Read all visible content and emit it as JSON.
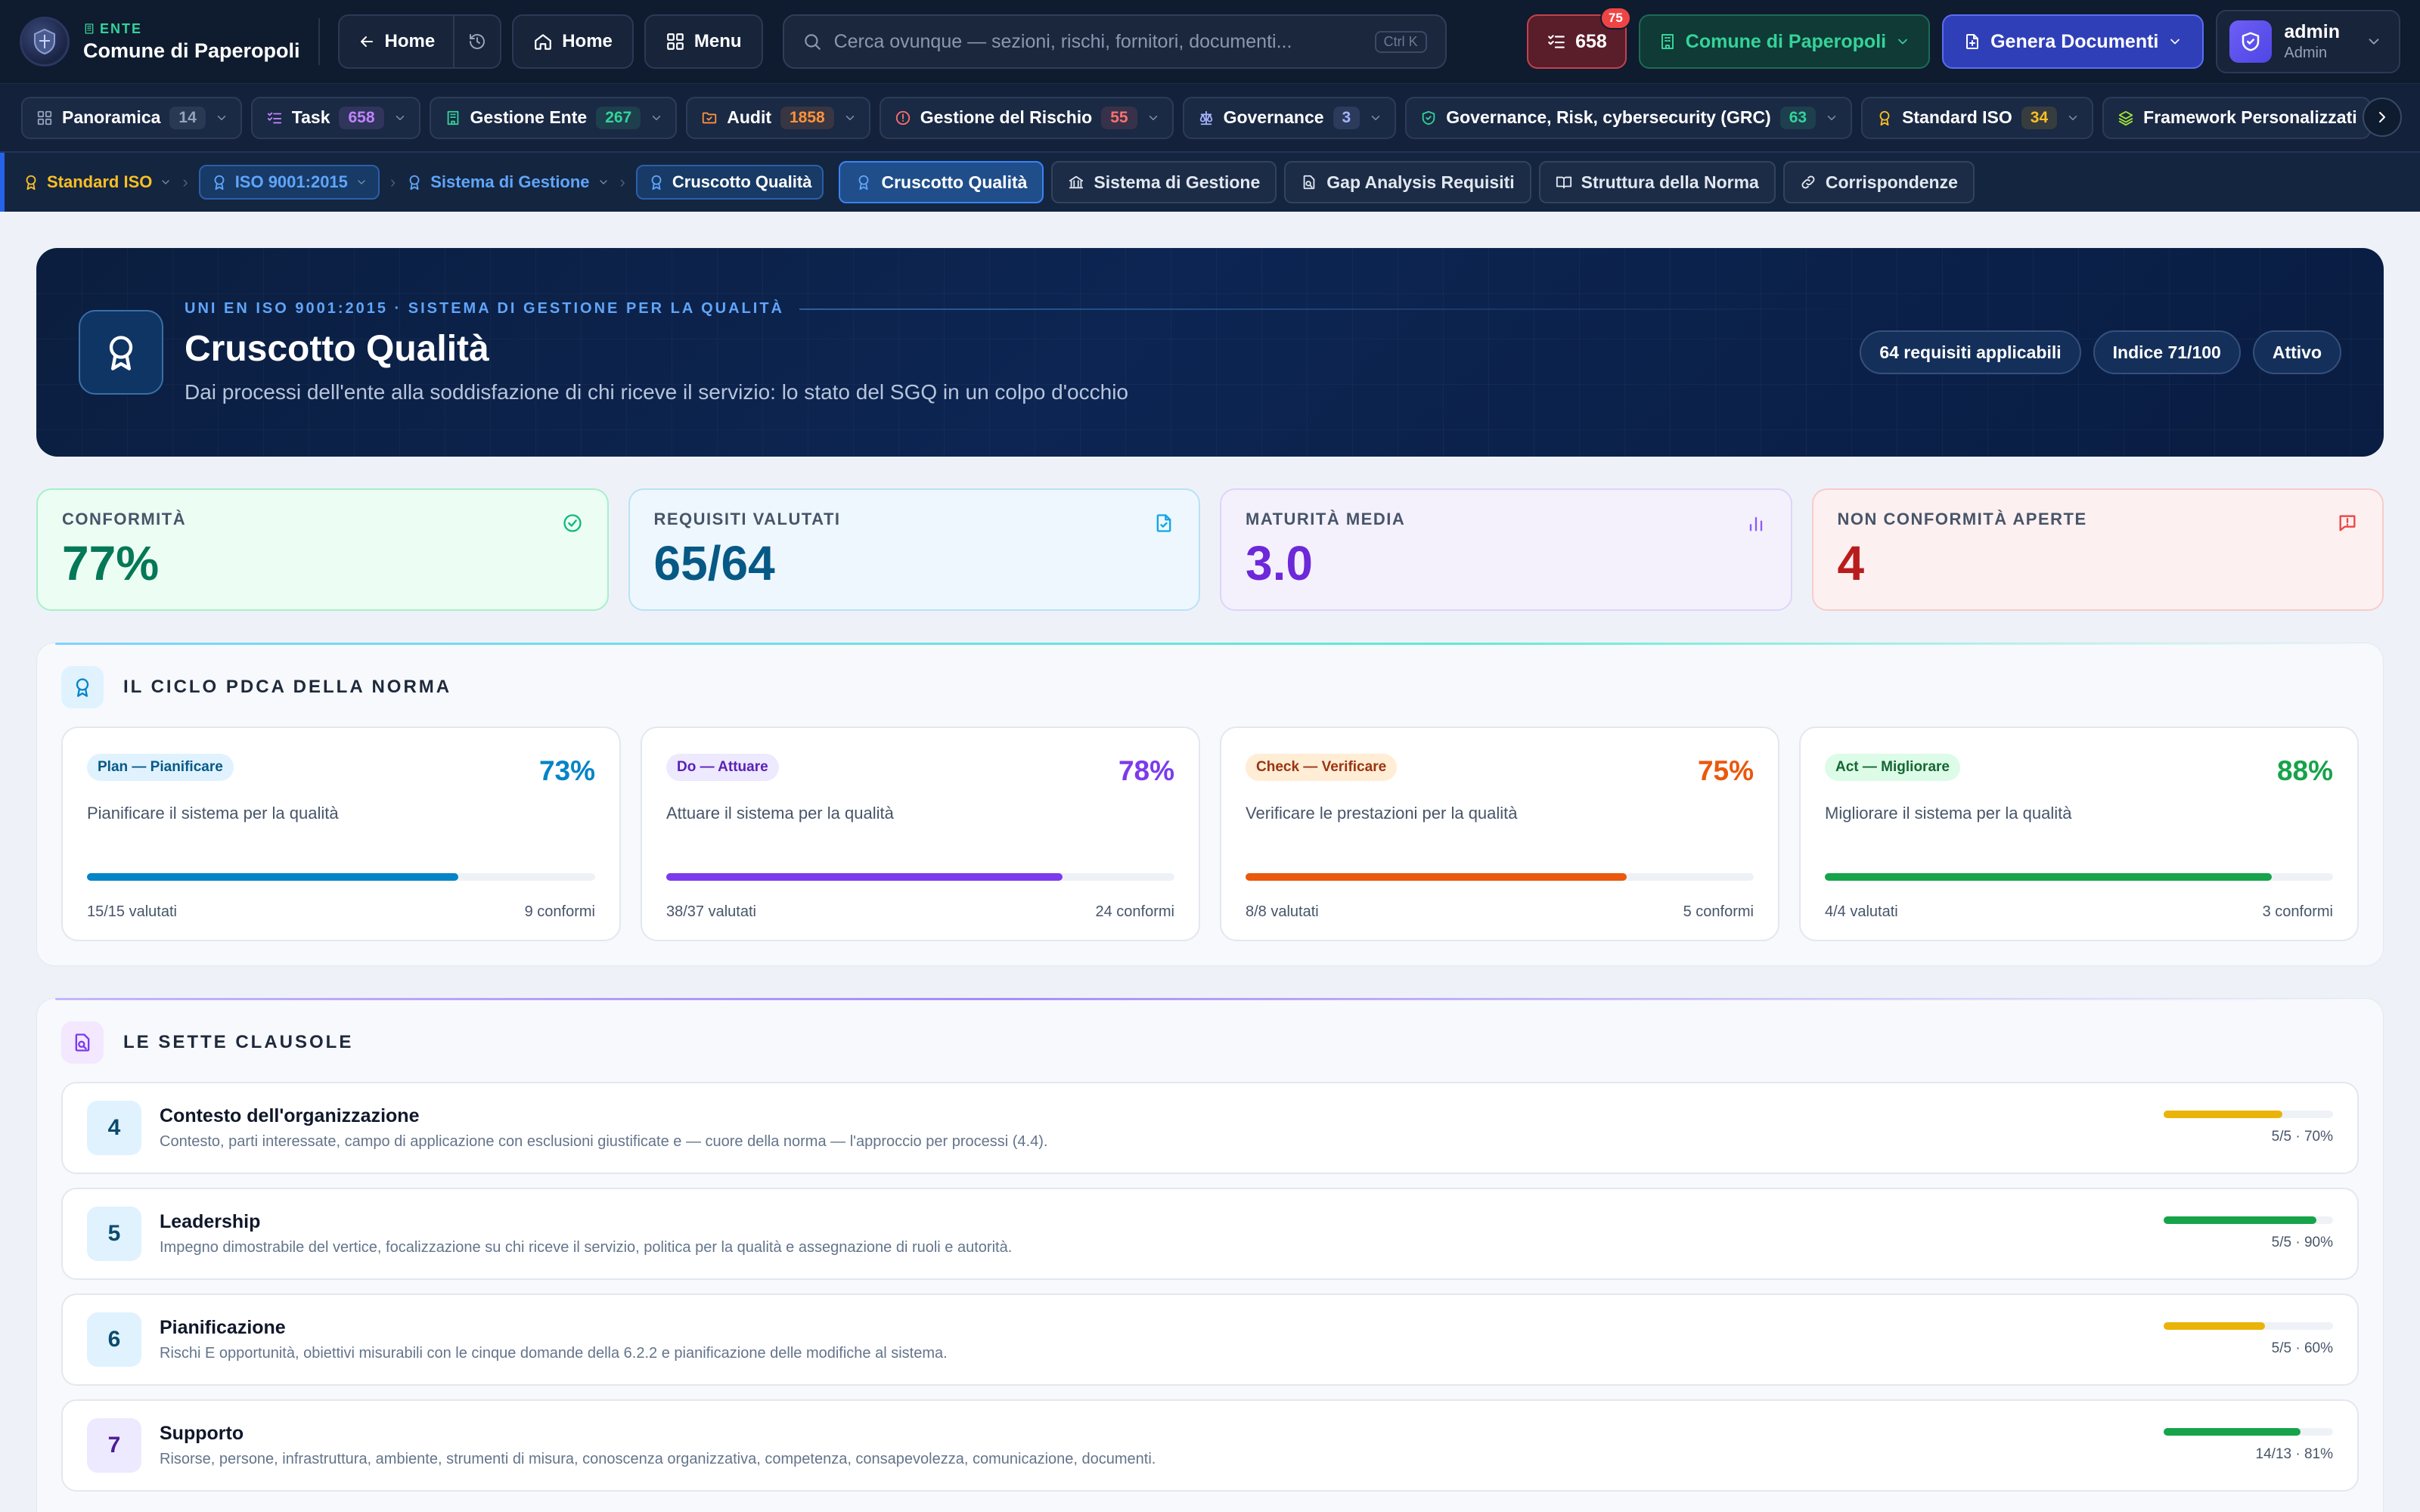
{
  "topbar": {
    "ente_tag": "ENTE",
    "ente_name": "Comune di Paperopoli",
    "back_home": "Home",
    "home": "Home",
    "menu": "Menu",
    "search_placeholder": "Cerca ovunque — sezioni, rischi, fornitori, documenti...",
    "search_shortcut": "Ctrl K",
    "tasks_count": "658",
    "tasks_badge": "75",
    "org": "Comune di Paperopoli",
    "generate": "Genera Documenti",
    "user_name": "admin",
    "user_role": "Admin"
  },
  "modules": [
    {
      "label": "Panoramica",
      "count": "14",
      "icon": "grid-icon",
      "color": "#94a3b8"
    },
    {
      "label": "Task",
      "count": "658",
      "icon": "checklist-icon",
      "color": "#c084fc"
    },
    {
      "label": "Gestione Ente",
      "count": "267",
      "icon": "building-icon",
      "color": "#34d399"
    },
    {
      "label": "Audit",
      "count": "1858",
      "icon": "folder-icon",
      "color": "#fb923c"
    },
    {
      "label": "Gestione del Rischio",
      "count": "55",
      "icon": "alert-icon",
      "color": "#f87171"
    },
    {
      "label": "Governance",
      "count": "3",
      "icon": "scale-icon",
      "color": "#a5b4fc"
    },
    {
      "label": "Governance, Risk, cybersecurity (GRC)",
      "count": "63",
      "icon": "shield-icon",
      "color": "#34d399"
    },
    {
      "label": "Standard ISO",
      "count": "34",
      "icon": "award-icon",
      "color": "#fbbf24"
    },
    {
      "label": "Framework Personalizzati",
      "count": "",
      "icon": "layers-icon",
      "color": "#a3e635"
    }
  ],
  "breadcrumb": {
    "items": [
      "Standard ISO",
      "ISO 9001:2015",
      "Sistema di Gestione",
      "Cruscotto Qualità"
    ],
    "tabs": [
      "Cruscotto Qualità",
      "Sistema di Gestione",
      "Gap Analysis Requisiti",
      "Struttura della Norma",
      "Corrispondenze"
    ]
  },
  "hero": {
    "eyebrow": "UNI EN ISO 9001:2015 · SISTEMA DI GESTIONE PER LA QUALITÀ",
    "title": "Cruscotto Qualità",
    "subtitle": "Dai processi dell'ente alla soddisfazione di chi riceve il servizio: lo stato del SGQ in un colpo d'occhio",
    "pills": [
      "64 requisiti applicabili",
      "Indice 71/100",
      "Attivo"
    ]
  },
  "kpis": [
    {
      "label": "CONFORMITÀ",
      "value": "77%",
      "icon": "check-circle-icon",
      "color": "#047857"
    },
    {
      "label": "REQUISITI VALUTATI",
      "value": "65/64",
      "icon": "file-check-icon",
      "color": "#075985"
    },
    {
      "label": "MATURITÀ MEDIA",
      "value": "3.0",
      "icon": "bar-chart-icon",
      "color": "#6d28d9"
    },
    {
      "label": "NON CONFORMITÀ APERTE",
      "value": "4",
      "icon": "message-alert-icon",
      "color": "#b91c1c"
    }
  ],
  "pdca": {
    "title": "IL CICLO PDCA DELLA NORMA",
    "cards": [
      {
        "tag": "Plan — Pianificare",
        "pct": "73%",
        "progress": 0.73,
        "desc": "Pianificare il sistema per la qualità",
        "evaluated": "15/15 valutati",
        "conform": "9 conformi",
        "color": "#0284c7"
      },
      {
        "tag": "Do — Attuare",
        "pct": "78%",
        "progress": 0.78,
        "desc": "Attuare il sistema per la qualità",
        "evaluated": "38/37 valutati",
        "conform": "24 conformi",
        "color": "#7c3aed"
      },
      {
        "tag": "Check — Verificare",
        "pct": "75%",
        "progress": 0.75,
        "desc": "Verificare le prestazioni per la qualità",
        "evaluated": "8/8 valutati",
        "conform": "5 conformi",
        "color": "#ea580c"
      },
      {
        "tag": "Act — Migliorare",
        "pct": "88%",
        "progress": 0.88,
        "desc": "Migliorare il sistema per la qualità",
        "evaluated": "4/4 valutati",
        "conform": "3 conformi",
        "color": "#16a34a"
      }
    ]
  },
  "clauses": {
    "title": "LE SETTE CLAUSOLE",
    "items": [
      {
        "num": "4",
        "title": "Contesto dell'organizzazione",
        "desc": "Contesto, parti interessate, campo di applicazione con esclusioni giustificate e — cuore della norma — l'approccio per processi (4.4).",
        "stat": "5/5 · 70%",
        "progress": 0.7,
        "color": "#eab308"
      },
      {
        "num": "5",
        "title": "Leadership",
        "desc": "Impegno dimostrabile del vertice, focalizzazione su chi riceve il servizio, politica per la qualità e assegnazione di ruoli e autorità.",
        "stat": "5/5 · 90%",
        "progress": 0.9,
        "color": "#16a34a"
      },
      {
        "num": "6",
        "title": "Pianificazione",
        "desc": "Rischi E opportunità, obiettivi misurabili con le cinque domande della 6.2.2 e pianificazione delle modifiche al sistema.",
        "stat": "5/5 · 60%",
        "progress": 0.6,
        "color": "#eab308"
      },
      {
        "num": "7",
        "title": "Supporto",
        "desc": "Risorse, persone, infrastruttura, ambiente, strumenti di misura, conoscenza organizzativa, competenza, consapevolezza, comunicazione, documenti.",
        "stat": "14/13 · 81%",
        "progress": 0.81,
        "color": "#16a34a"
      }
    ]
  }
}
